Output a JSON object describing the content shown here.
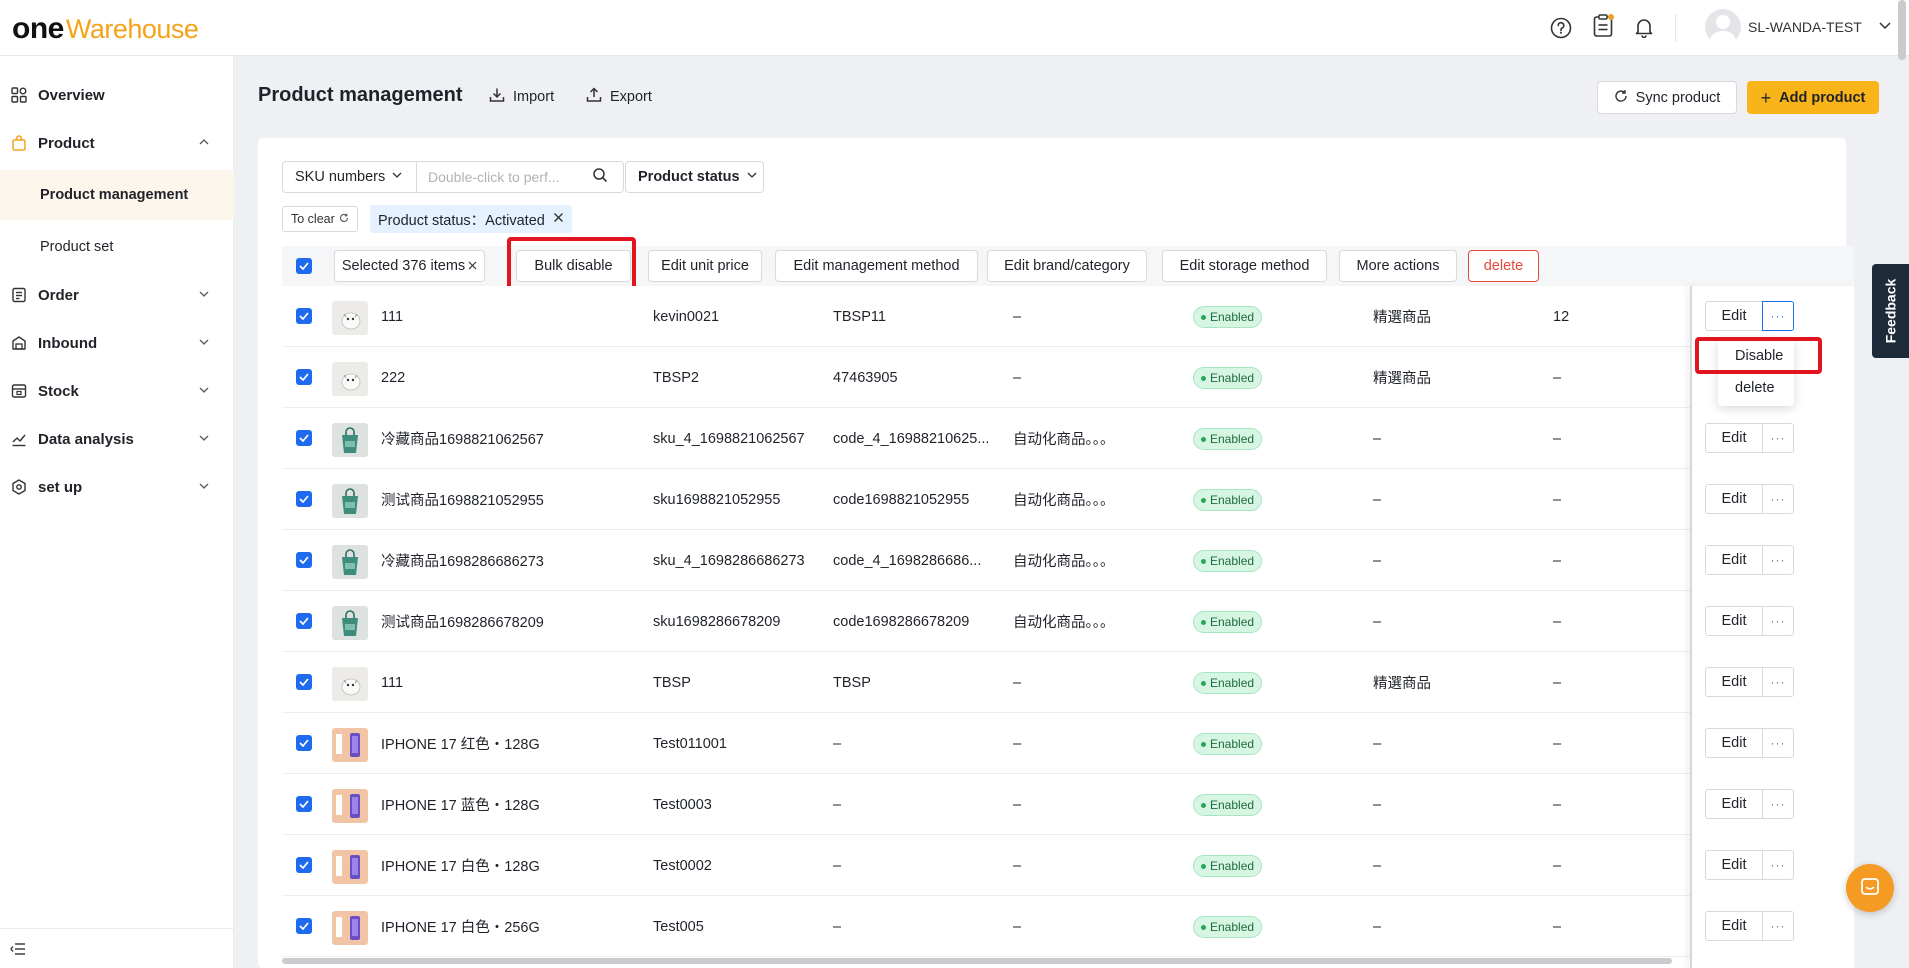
{
  "brand": {
    "one": "one",
    "warehouse": "Warehouse"
  },
  "header": {
    "username": "SL-WANDA-TEST"
  },
  "sidebar": {
    "items": [
      {
        "label": "Overview"
      },
      {
        "label": "Product"
      },
      {
        "label": "Order"
      },
      {
        "label": "Inbound"
      },
      {
        "label": "Stock"
      },
      {
        "label": "Data analysis"
      },
      {
        "label": "set up"
      }
    ],
    "sub_items": [
      {
        "label": "Product management"
      },
      {
        "label": "Product set"
      }
    ]
  },
  "page": {
    "title": "Product management",
    "import": "Import",
    "export": "Export",
    "sync": "Sync product",
    "add": "Add product"
  },
  "filters": {
    "sku_select": "SKU numbers",
    "search_placeholder": "Double-click to perf...",
    "status_select": "Product status",
    "clear": "To clear",
    "active_tag": "Product status：Activated"
  },
  "toolbar": {
    "selected": "Selected 376 items",
    "bulk_disable": "Bulk disable",
    "edit_unit_price": "Edit unit price",
    "edit_management": "Edit management method",
    "edit_brand": "Edit brand/category",
    "edit_storage": "Edit storage method",
    "more_actions": "More actions",
    "delete": "delete"
  },
  "row_actions": {
    "edit": "Edit",
    "more": "···"
  },
  "dropdown": {
    "disable": "Disable",
    "delete": "delete"
  },
  "feedback": "Feedback",
  "rows": [
    {
      "name": "111",
      "sku": "kevin0021",
      "code": "TBSP11",
      "category": "–",
      "status": "Enabled",
      "set": "精選商品",
      "qty": "12",
      "thumb": "cat"
    },
    {
      "name": "222",
      "sku": "TBSP2",
      "code": "47463905",
      "category": "–",
      "status": "Enabled",
      "set": "精選商品",
      "qty": "–",
      "thumb": "cat"
    },
    {
      "name": "冷藏商品1698821062567",
      "sku": "sku_4_1698821062567",
      "code": "code_4_16988210625...",
      "category": "自动化商品。。。",
      "status": "Enabled",
      "set": "–",
      "qty": "–",
      "thumb": "bag"
    },
    {
      "name": "测试商品1698821052955",
      "sku": "sku1698821052955",
      "code": "code1698821052955",
      "category": "自动化商品。。。",
      "status": "Enabled",
      "set": "–",
      "qty": "–",
      "thumb": "bag"
    },
    {
      "name": "冷藏商品1698286686273",
      "sku": "sku_4_1698286686273",
      "code": "code_4_1698286686...",
      "category": "自动化商品。。。",
      "status": "Enabled",
      "set": "–",
      "qty": "–",
      "thumb": "bag"
    },
    {
      "name": "测试商品1698286678209",
      "sku": "sku1698286678209",
      "code": "code1698286678209",
      "category": "自动化商品。。。",
      "status": "Enabled",
      "set": "–",
      "qty": "–",
      "thumb": "bag"
    },
    {
      "name": "111",
      "sku": "TBSP",
      "code": "TBSP",
      "category": "–",
      "status": "Enabled",
      "set": "精選商品",
      "qty": "–",
      "thumb": "cat"
    },
    {
      "name": "IPHONE 17 红色・128G",
      "sku": "Test011001",
      "code": "–",
      "category": "–",
      "status": "Enabled",
      "set": "–",
      "qty": "–",
      "thumb": "phone"
    },
    {
      "name": "IPHONE 17 蓝色・128G",
      "sku": "Test0003",
      "code": "–",
      "category": "–",
      "status": "Enabled",
      "set": "–",
      "qty": "–",
      "thumb": "phone"
    },
    {
      "name": "IPHONE 17 白色・128G",
      "sku": "Test0002",
      "code": "–",
      "category": "–",
      "status": "Enabled",
      "set": "–",
      "qty": "–",
      "thumb": "phone"
    },
    {
      "name": "IPHONE 17 白色・256G",
      "sku": "Test005",
      "code": "–",
      "category": "–",
      "status": "Enabled",
      "set": "–",
      "qty": "–",
      "thumb": "phone"
    }
  ],
  "colors": {
    "accent": "#f8b418",
    "checkbox": "#1f6bf0",
    "highlight": "#e2141f",
    "enabled": "#26a65b",
    "danger": "#e8483a"
  }
}
